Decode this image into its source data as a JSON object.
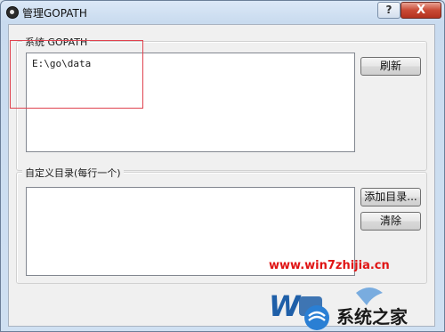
{
  "window": {
    "title": "管理GOPATH"
  },
  "title_buttons": {
    "help": "?",
    "close": "X"
  },
  "system_group": {
    "legend": "系统 GOPATH",
    "path_value": "E:\\go\\data",
    "refresh_button": "刷新"
  },
  "custom_group": {
    "legend": "自定义目录(每行一个)",
    "path_value": "",
    "add_button": "添加目录...",
    "clear_button": "清除"
  },
  "watermark": {
    "url": "www.win7zhijia.cn",
    "logo_text": "系统之家"
  },
  "colors": {
    "highlight": "#e0434f",
    "watermark_url": "#e01414",
    "logo_blue": "#1f5fa8"
  }
}
